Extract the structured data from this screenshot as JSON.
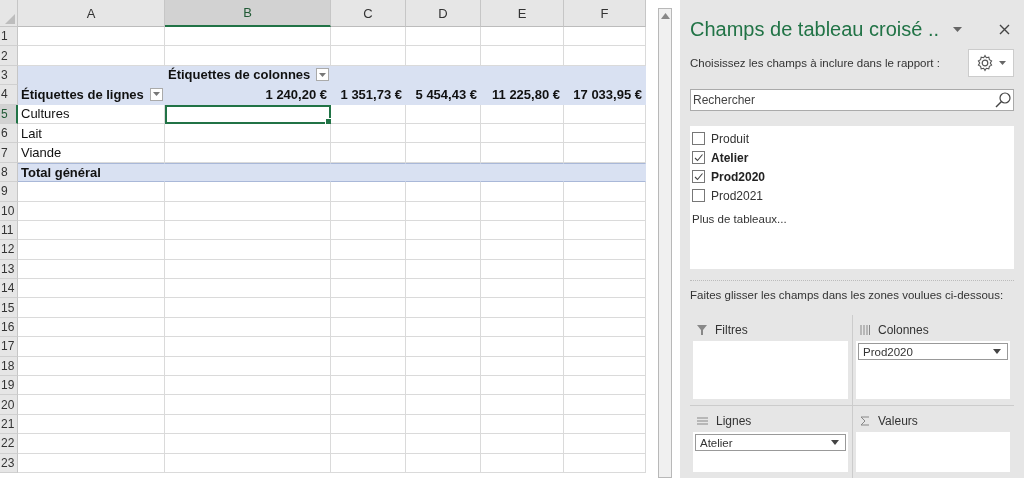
{
  "sheet": {
    "columns": [
      {
        "label": "A",
        "selected": false
      },
      {
        "label": "B",
        "selected": true
      },
      {
        "label": "C",
        "selected": false
      },
      {
        "label": "D",
        "selected": false
      },
      {
        "label": "E",
        "selected": false
      },
      {
        "label": "F",
        "selected": false
      }
    ],
    "rows": [
      {
        "number": "1",
        "kind": "plain",
        "selected": false,
        "cells": {}
      },
      {
        "number": "2",
        "kind": "plain",
        "selected": false,
        "cells": {}
      },
      {
        "number": "3",
        "kind": "pivot",
        "selected": false,
        "cells": {
          "B": {
            "text": "Étiquettes de colonnes",
            "filter_button": true
          }
        }
      },
      {
        "number": "4",
        "kind": "pivot",
        "selected": false,
        "cells": {
          "A": {
            "text": "Étiquettes de lignes",
            "filter_button": true
          },
          "B": {
            "text": "1 240,20 €"
          },
          "C": {
            "text": "1 351,73 €"
          },
          "D": {
            "text": "5 454,43 €"
          },
          "E": {
            "text": "11 225,80 €"
          },
          "F": {
            "text": "17 033,95 €"
          }
        }
      },
      {
        "number": "5",
        "kind": "plain",
        "selected": true,
        "cells": {
          "A": {
            "text": "Cultures"
          },
          "B": {
            "active": true
          }
        }
      },
      {
        "number": "6",
        "kind": "plain",
        "selected": false,
        "cells": {
          "A": {
            "text": "Lait"
          }
        }
      },
      {
        "number": "7",
        "kind": "plain",
        "selected": false,
        "cells": {
          "A": {
            "text": "Viande"
          }
        }
      },
      {
        "number": "8",
        "kind": "total",
        "selected": false,
        "cells": {
          "A": {
            "text": "Total général"
          }
        }
      },
      {
        "number": "9",
        "kind": "plain",
        "selected": false,
        "cells": {}
      },
      {
        "number": "10",
        "kind": "plain",
        "selected": false,
        "cells": {}
      },
      {
        "number": "11",
        "kind": "plain",
        "selected": false,
        "cells": {}
      },
      {
        "number": "12",
        "kind": "plain",
        "selected": false,
        "cells": {}
      },
      {
        "number": "13",
        "kind": "plain",
        "selected": false,
        "cells": {}
      },
      {
        "number": "14",
        "kind": "plain",
        "selected": false,
        "cells": {}
      },
      {
        "number": "15",
        "kind": "plain",
        "selected": false,
        "cells": {}
      },
      {
        "number": "16",
        "kind": "plain",
        "selected": false,
        "cells": {}
      },
      {
        "number": "17",
        "kind": "plain",
        "selected": false,
        "cells": {}
      },
      {
        "number": "18",
        "kind": "plain",
        "selected": false,
        "cells": {}
      },
      {
        "number": "19",
        "kind": "plain",
        "selected": false,
        "cells": {}
      },
      {
        "number": "20",
        "kind": "plain",
        "selected": false,
        "cells": {}
      },
      {
        "number": "21",
        "kind": "plain",
        "selected": false,
        "cells": {}
      },
      {
        "number": "22",
        "kind": "plain",
        "selected": false,
        "cells": {}
      },
      {
        "number": "23",
        "kind": "plain",
        "selected": false,
        "cells": {}
      }
    ]
  },
  "panel": {
    "title": "Champs de tableau croisé ..",
    "subtitle": "Choisissez les champs à inclure dans le rapport :",
    "search": {
      "placeholder": "Rechercher"
    },
    "fields": [
      {
        "label": "Produit",
        "checked": false
      },
      {
        "label": "Atelier",
        "checked": true
      },
      {
        "label": "Prod2020",
        "checked": true
      },
      {
        "label": "Prod2021",
        "checked": false
      }
    ],
    "more_tables": "Plus de tableaux...",
    "instruction": "Faites glisser les champs dans les zones voulues ci-dessous:",
    "areas": [
      {
        "kind": "filters",
        "label": "Filtres"
      },
      {
        "kind": "columns",
        "label": "Colonnes",
        "items": [
          "Prod2020"
        ]
      },
      {
        "kind": "rows",
        "label": "Lignes",
        "items": [
          "Atelier"
        ]
      },
      {
        "kind": "values",
        "label": "Valeurs"
      }
    ]
  }
}
